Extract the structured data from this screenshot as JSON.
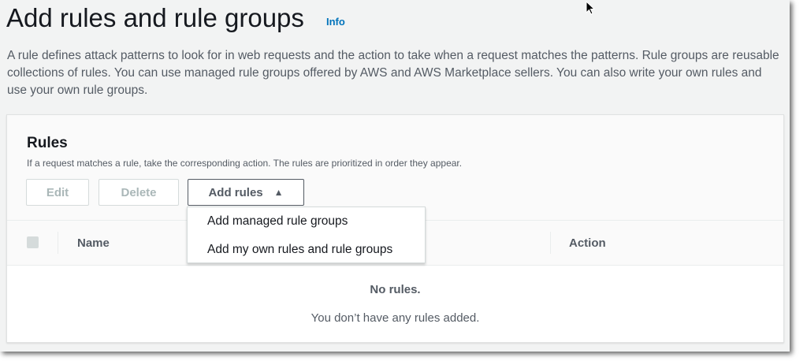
{
  "header": {
    "title": "Add rules and rule groups",
    "info_link": "Info",
    "description": "A rule defines attack patterns to look for in web requests and the action to take when a request matches the patterns. Rule groups are reusable collections of rules. You can use managed rule groups offered by AWS and AWS Marketplace sellers. You can also write your own rules and use your own rule groups."
  },
  "rules": {
    "title": "Rules",
    "subtitle": "If a request matches a rule, take the corresponding action. The rules are prioritized in order they appear.",
    "buttons": {
      "edit": "Edit",
      "delete": "Delete",
      "add_rules": "Add rules"
    },
    "menu": [
      "Add managed rule groups",
      "Add my own rules and rule groups"
    ],
    "columns": [
      "Name",
      "Action"
    ],
    "empty_title": "No rules.",
    "empty_message": "You don’t have any rules added."
  }
}
